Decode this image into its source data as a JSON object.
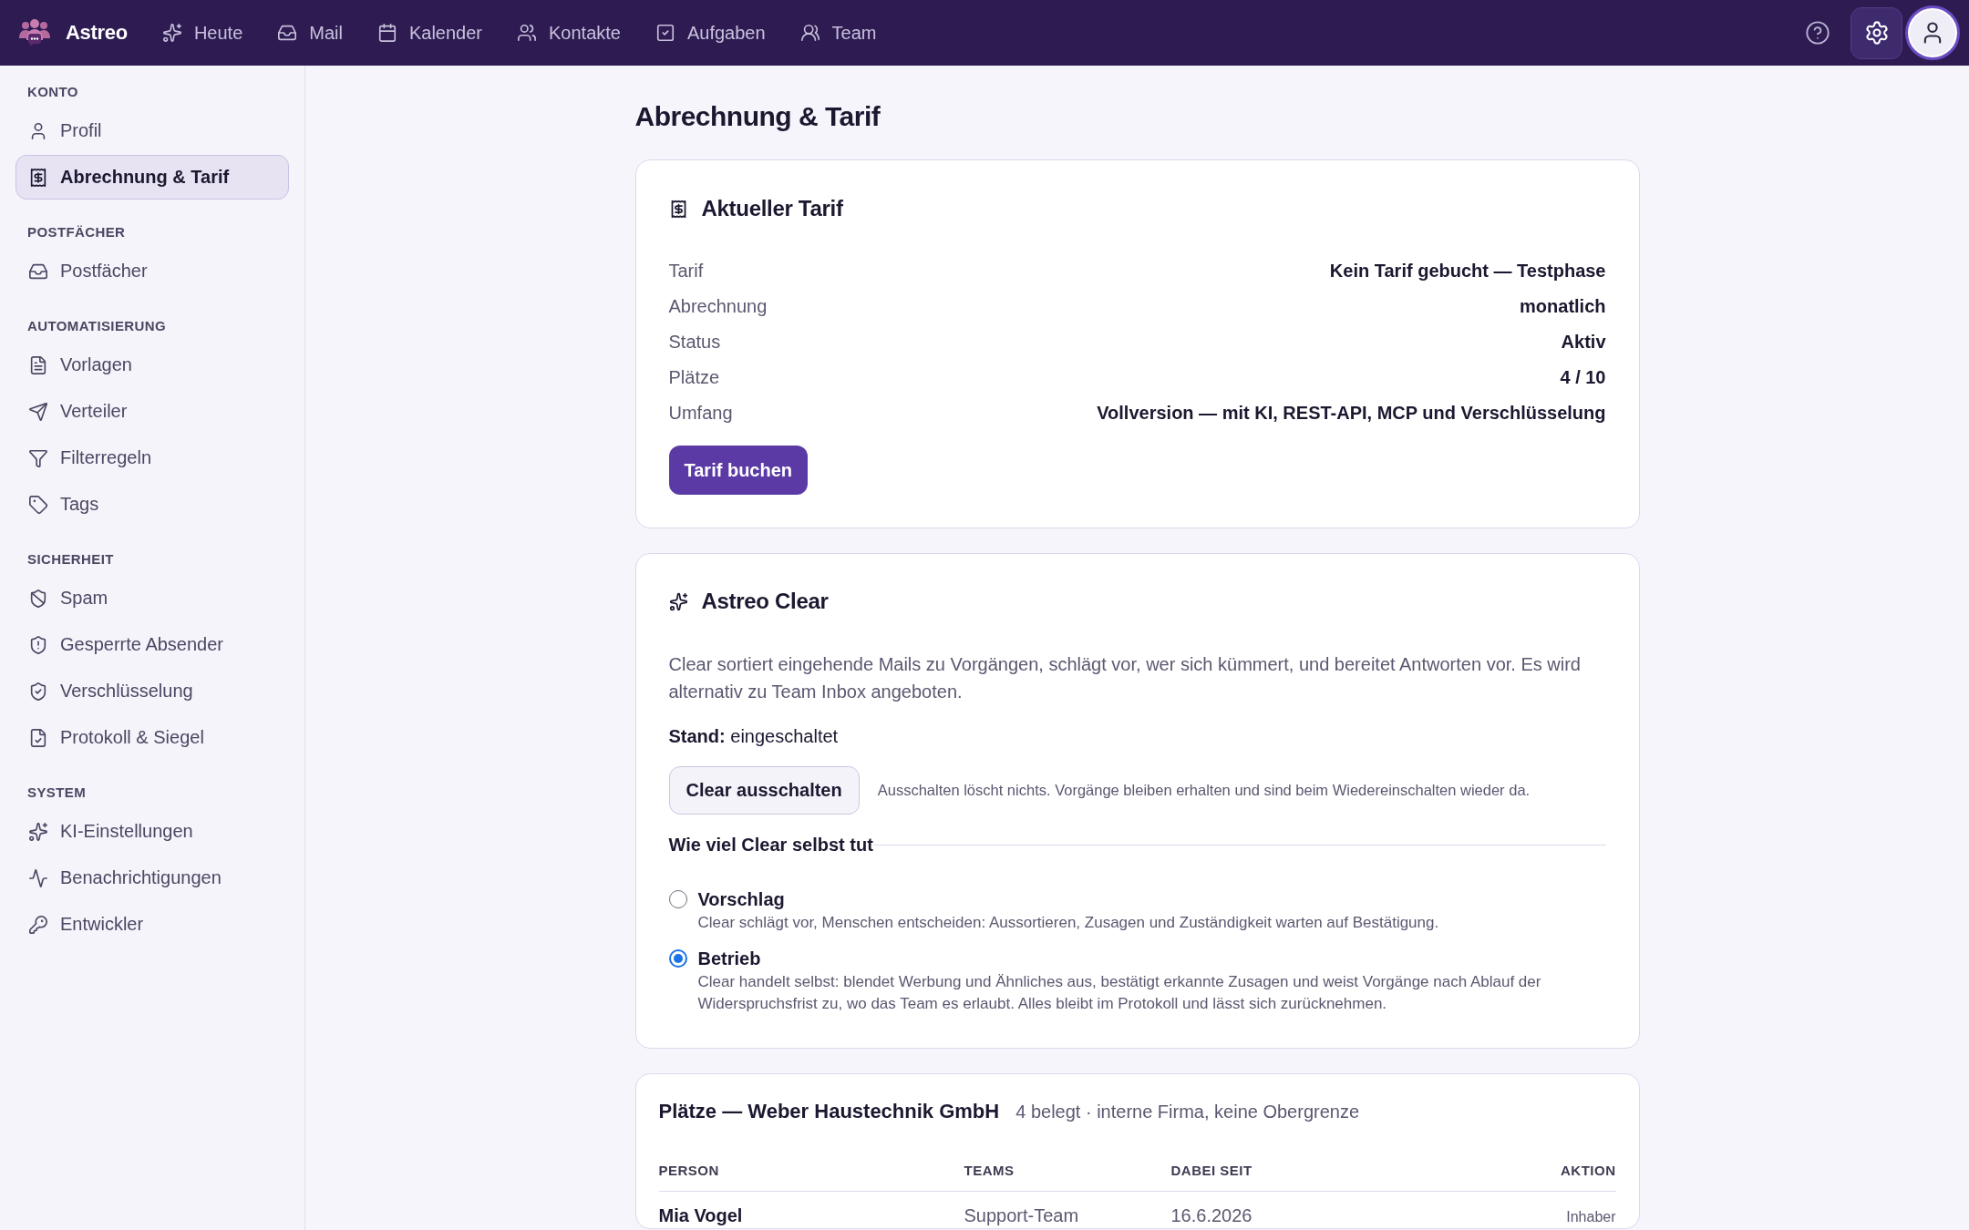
{
  "topbar": {
    "brand": "Astreo",
    "nav": [
      {
        "label": "Heute",
        "selected": false
      },
      {
        "label": "Mail",
        "selected": false
      },
      {
        "label": "Kalender",
        "selected": false
      },
      {
        "label": "Kontakte",
        "selected": false
      },
      {
        "label": "Aufgaben",
        "selected": false
      },
      {
        "label": "Team",
        "selected": false
      }
    ],
    "settings": {
      "selected": true
    }
  },
  "sidebar": {
    "sections": [
      {
        "heading": "KONTO",
        "items": [
          {
            "label": "Profil",
            "selected": false
          },
          {
            "label": "Abrechnung & Tarif",
            "selected": true
          }
        ]
      },
      {
        "heading": "POSTFÄCHER",
        "items": [
          {
            "label": "Postfächer",
            "selected": false
          }
        ]
      },
      {
        "heading": "AUTOMATISIERUNG",
        "items": [
          {
            "label": "Vorlagen",
            "selected": false
          },
          {
            "label": "Verteiler",
            "selected": false
          },
          {
            "label": "Filterregeln",
            "selected": false
          },
          {
            "label": "Tags",
            "selected": false
          }
        ]
      },
      {
        "heading": "SICHERHEIT",
        "items": [
          {
            "label": "Spam",
            "selected": false
          },
          {
            "label": "Gesperrte Absender",
            "selected": false
          },
          {
            "label": "Verschlüsselung",
            "selected": false
          },
          {
            "label": "Protokoll & Siegel",
            "selected": false
          }
        ]
      },
      {
        "heading": "SYSTEM",
        "items": [
          {
            "label": "KI-Einstellungen",
            "selected": false
          },
          {
            "label": "Benachrichtigungen",
            "selected": false
          },
          {
            "label": "Entwickler",
            "selected": false
          }
        ]
      }
    ]
  },
  "page": {
    "title": "Abrechnung & Tarif"
  },
  "plan_card": {
    "title": "Aktueller Tarif",
    "rows": [
      {
        "label": "Tarif",
        "value": "Kein Tarif gebucht — Testphase"
      },
      {
        "label": "Abrechnung",
        "value": "monatlich"
      },
      {
        "label": "Status",
        "value": "Aktiv"
      },
      {
        "label": "Plätze",
        "value": "4 / 10"
      },
      {
        "label": "Umfang",
        "value": "Vollversion — mit KI, REST-API, MCP und Verschlüsselung"
      }
    ],
    "button": "Tarif buchen"
  },
  "clear_card": {
    "title": "Astreo Clear",
    "description": "Clear sortiert eingehende Mails zu Vorgängen, schlägt vor, wer sich kümmert, und bereitet Antworten vor. Es wird alternativ zu Team Inbox angeboten.",
    "status": "**Stand:** eingeschaltet",
    "button": "Clear ausschalten",
    "note": "Ausschalten löscht nichts. Vorgänge bleiben erhalten und sind beim Wiedereinschalten wieder da.",
    "mode_heading": "Wie viel Clear selbst tut",
    "modes": [
      {
        "label": "Vorschlag",
        "description": "Clear schlägt vor, Menschen entscheiden: Aussortieren, Zusagen und Zuständigkeit warten auf Bestätigung.",
        "selected": false
      },
      {
        "label": "Betrieb",
        "description": "Clear handelt selbst: blendet Werbung und Ähnliches aus, bestätigt erkannte Zusagen und weist Vorgänge nach Ablauf der Widerspruchsfrist zu, wo das Team es erlaubt. Alles bleibt im Protokoll und lässt sich zurücknehmen.",
        "selected": true
      }
    ]
  },
  "seats_card": {
    "title": "Plätze — Weber Haustechnik GmbH",
    "summary": "4 belegt · interne Firma, keine Obergrenze",
    "columns": [
      "PERSON",
      "TEAMS",
      "DABEI SEIT",
      "AKTION"
    ],
    "rows": [
      {
        "person": "Mia Vogel",
        "teams": "Support-Team",
        "since": "16.6.2026",
        "action": "Inhaber"
      }
    ]
  }
}
